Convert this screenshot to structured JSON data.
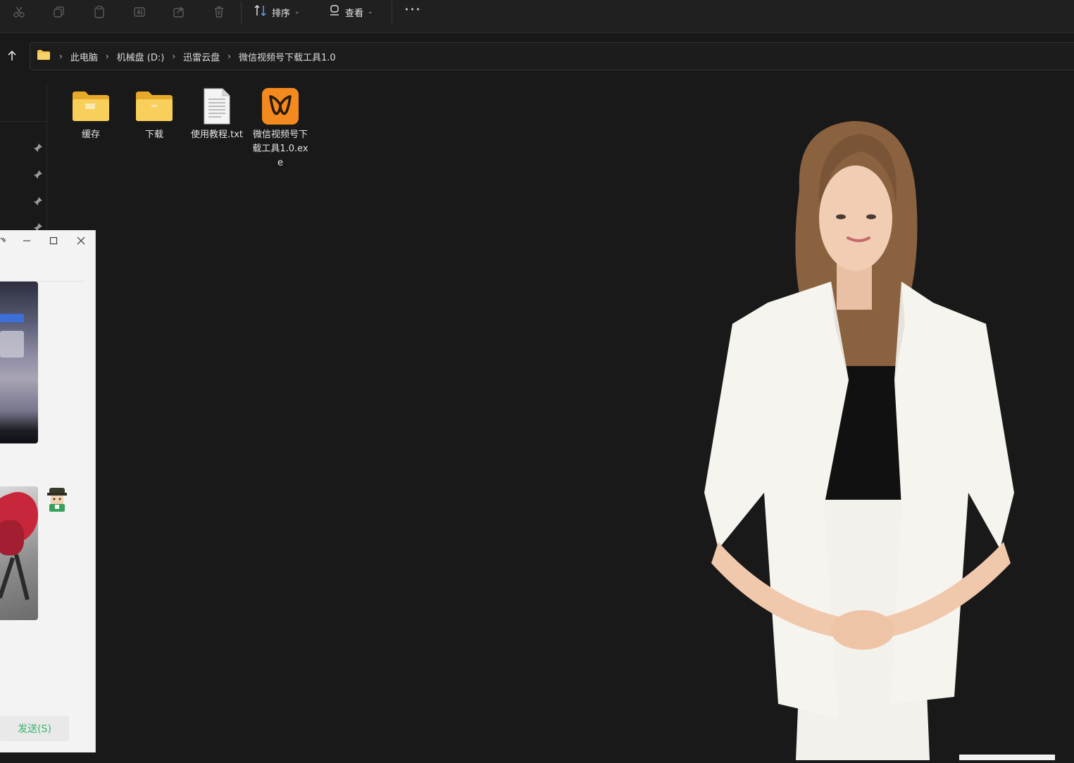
{
  "toolbar": {
    "sort_label": "排序",
    "view_label": "查看",
    "more_label": "···",
    "icons": [
      "cut-icon",
      "copy-icon",
      "paste-icon",
      "rename-icon",
      "share-icon",
      "delete-icon",
      "sort-icon",
      "view-icon"
    ]
  },
  "address": {
    "crumbs": [
      "此电脑",
      "机械盘 (D:)",
      "迅雷云盘",
      "微信视频号下载工具1.0"
    ],
    "separator": "›"
  },
  "files": [
    {
      "name": "缓存",
      "type": "folder"
    },
    {
      "name": "下载",
      "type": "folder"
    },
    {
      "name": "使用教程.txt",
      "type": "text"
    },
    {
      "name": "微信视频号下载工具1.0.exe",
      "type": "app"
    }
  ],
  "chat": {
    "send_label": "发送(S)"
  },
  "colors": {
    "background": "#191919",
    "folder": "#f4c24d",
    "app_icon": "#f28a1f",
    "send_text": "#34b36b"
  }
}
